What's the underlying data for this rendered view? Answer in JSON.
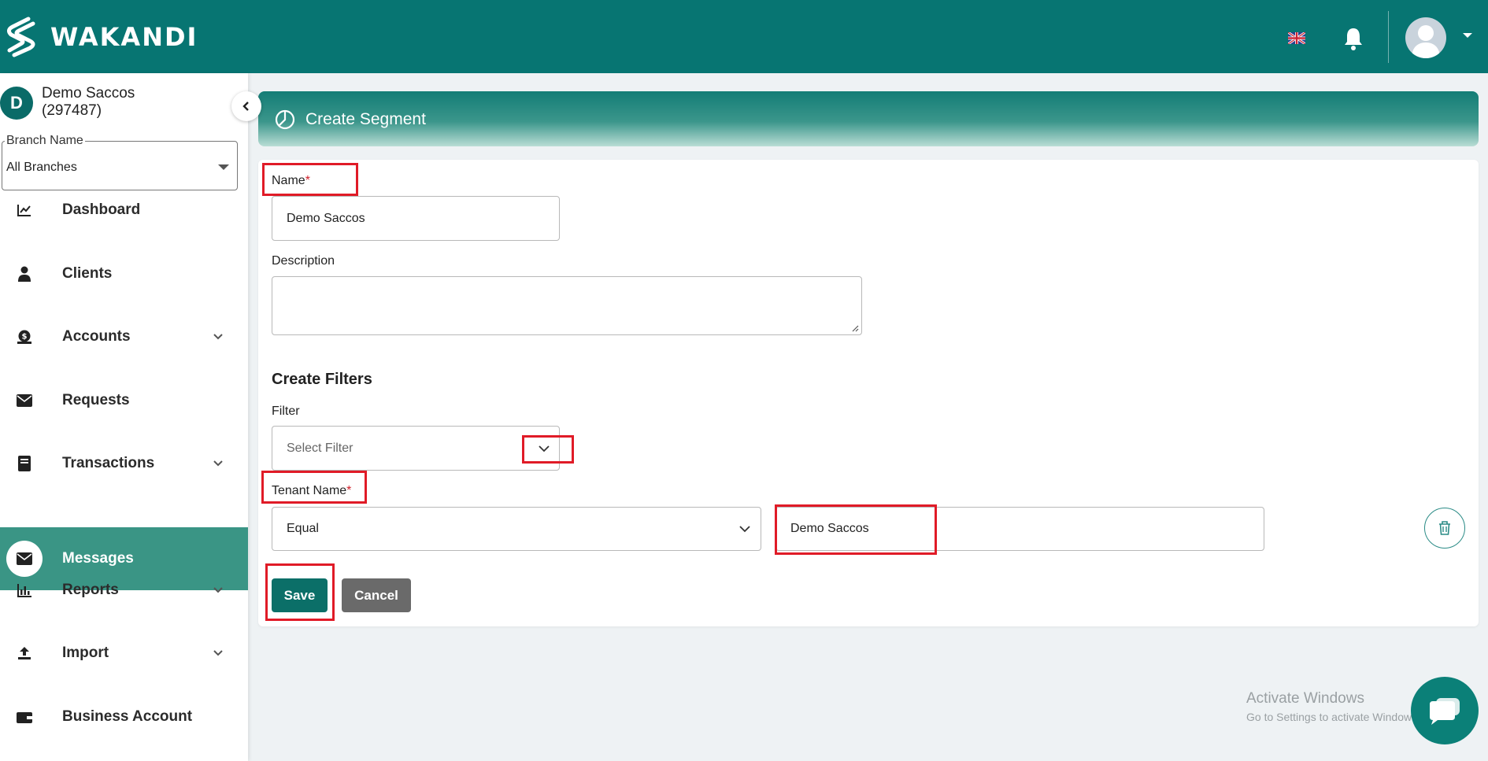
{
  "app": {
    "brand": "WAKANDI",
    "colors": {
      "primary": "#077572",
      "active_nav": "#3a9585",
      "required": "#d0212b",
      "annotation": "#e01b27"
    }
  },
  "topbar": {
    "language_icon": "uk-flag-icon",
    "notification_icon": "bell-icon",
    "avatar_icon": "user-avatar-icon"
  },
  "sidebar": {
    "org_initial": "D",
    "org_name": "Demo Saccos",
    "org_code": "(297487)",
    "branch": {
      "label": "Branch Name",
      "value": "All Branches"
    },
    "items": [
      {
        "label": "Dashboard",
        "icon": "chart-line-icon",
        "expandable": false
      },
      {
        "label": "Clients",
        "icon": "person-icon",
        "expandable": false
      },
      {
        "label": "Accounts",
        "icon": "money-bag-icon",
        "expandable": true
      },
      {
        "label": "Requests",
        "icon": "envelope-icon",
        "expandable": false
      },
      {
        "label": "Transactions",
        "icon": "book-icon",
        "expandable": true
      },
      {
        "label": "Messages",
        "icon": "envelope-icon",
        "expandable": false,
        "active": true
      },
      {
        "label": "Reports",
        "icon": "bar-chart-icon",
        "expandable": true
      },
      {
        "label": "Import",
        "icon": "upload-icon",
        "expandable": true
      },
      {
        "label": "Business Account",
        "icon": "wallet-icon",
        "expandable": false
      }
    ]
  },
  "page": {
    "title": "Create Segment",
    "title_icon": "pie-chart-icon"
  },
  "form": {
    "name_label": "Name",
    "required_mark": "*",
    "name_value": "Demo Saccos",
    "description_label": "Description",
    "description_value": "",
    "filters_title": "Create Filters",
    "filter_label": "Filter",
    "filter_placeholder": "Select Filter",
    "tenant_label": "Tenant Name",
    "operator_value": "Equal",
    "tenant_value": "Demo Saccos",
    "save_label": "Save",
    "cancel_label": "Cancel"
  },
  "watermark": {
    "line1": "Activate Windows",
    "line2": "Go to Settings to activate Windows."
  }
}
